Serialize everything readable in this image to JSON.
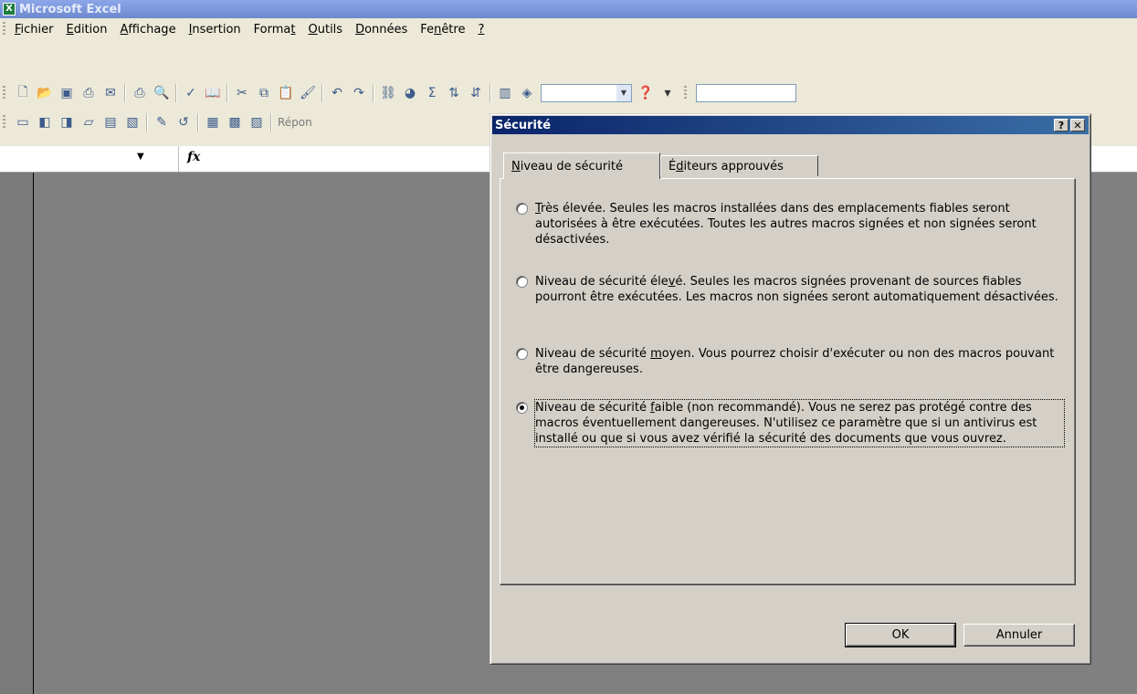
{
  "app": {
    "title": "Microsoft Excel",
    "icon": "excel-icon"
  },
  "menubar": {
    "items": [
      "Fichier",
      "Edition",
      "Affichage",
      "Insertion",
      "Format",
      "Outils",
      "Données",
      "Fenêtre",
      "?"
    ]
  },
  "toolbar_standard": {
    "icons": [
      "new-icon",
      "open-icon",
      "save-icon",
      "permission-icon",
      "email-icon",
      "print-icon",
      "print-preview-icon",
      "spelling-icon",
      "research-icon",
      "cut-icon",
      "copy-icon",
      "paste-icon",
      "format-painter-icon",
      "undo-icon",
      "redo-icon",
      "hyperlink-icon",
      "autosum-icon",
      "sort-asc-icon",
      "sort-desc-icon",
      "chart-wizard-icon",
      "drawing-icon",
      "help-icon"
    ],
    "autosum_symbol": "Σ",
    "zoom_value": ""
  },
  "toolbar_review": {
    "reply_label": "Répon"
  },
  "formula_bar": {
    "fx": "fx"
  },
  "dialog": {
    "title": "Sécurité",
    "help_symbol": "?",
    "close_symbol": "✕",
    "tabs": [
      {
        "prefix": "",
        "hotkey": "N",
        "rest": "iveau de sécurité"
      },
      {
        "prefix": "É",
        "hotkey": "d",
        "rest": "iteurs approuvés"
      }
    ],
    "options": [
      {
        "before": "",
        "hotkey": "T",
        "after": "rès élevée. Seules les macros installées dans des emplacements fiables seront autorisées à être exécutées. Toutes les autres macros signées et non signées seront désactivées.",
        "checked": false
      },
      {
        "before": "Niveau de sécurité éle",
        "hotkey": "v",
        "after": "é. Seules les macros signées provenant de sources fiables pourront être exécutées. Les macros non signées seront automatiquement désactivées.",
        "checked": false
      },
      {
        "before": "Niveau de sécurité ",
        "hotkey": "m",
        "after": "oyen. Vous pourrez choisir d'exécuter ou non des macros pouvant être dangereuses.",
        "checked": false
      },
      {
        "before": "Niveau de sécurité ",
        "hotkey": "f",
        "after": "aible (non recommandé). Vous ne serez pas protégé contre des macros éventuellement dangereuses. N'utilisez ce paramètre que si un antivirus est installé ou que si vous avez vérifié la sécurité des documents que vous ouvrez.",
        "checked": true
      }
    ],
    "ok_label": "OK",
    "cancel_label": "Annuler"
  },
  "colors": {
    "title_active": "#0a246a",
    "title_active_end": "#3a6ea5",
    "dialog_face": "#d4d0c8",
    "chrome_face": "#ece9d8",
    "workspace": "#808080"
  }
}
